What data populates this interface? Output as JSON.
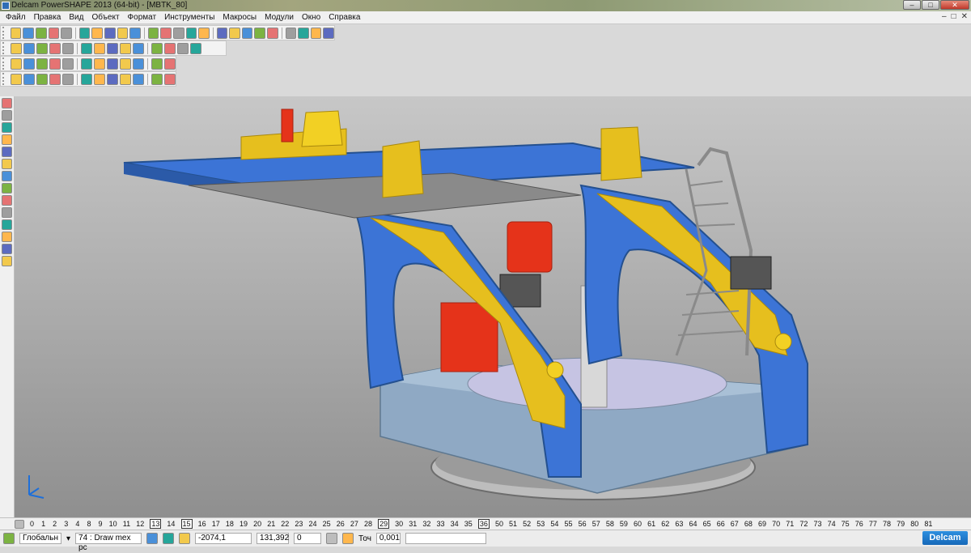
{
  "window": {
    "title": "Delcam PowerSHAPE 2013 (64-bit) - [MBTK_80]",
    "min": "–",
    "max": "□",
    "close": "✕"
  },
  "menu": [
    "Файл",
    "Правка",
    "Вид",
    "Объект",
    "Формат",
    "Инструменты",
    "Макросы",
    "Модули",
    "Окно",
    "Справка"
  ],
  "mdi_controls": [
    "–",
    "□",
    "✕"
  ],
  "toolbar_colors": [
    "#f2c94c",
    "#4a90d9",
    "#7cb342",
    "#e57373",
    "#9e9e9e",
    "#26a69a",
    "#ffb74d",
    "#5c6bc0"
  ],
  "levels": [
    "0",
    "1",
    "2",
    "3",
    "4",
    "8",
    "9",
    "10",
    "11",
    "12",
    "13",
    "14",
    "15",
    "16",
    "17",
    "18",
    "19",
    "20",
    "21",
    "22",
    "23",
    "24",
    "25",
    "26",
    "27",
    "28",
    "29",
    "30",
    "31",
    "32",
    "33",
    "34",
    "35",
    "36",
    "50",
    "51",
    "52",
    "53",
    "54",
    "55",
    "56",
    "57",
    "58",
    "59",
    "60",
    "61",
    "62",
    "63",
    "64",
    "65",
    "66",
    "67",
    "68",
    "69",
    "70",
    "71",
    "72",
    "73",
    "74",
    "75",
    "76",
    "77",
    "78",
    "79",
    "80",
    "81"
  ],
  "active_levels": [
    "13",
    "15",
    "29",
    "36"
  ],
  "status": {
    "workplane": "Глобальн",
    "level_value": "74 : Draw mex pc",
    "x_coord": "-2074,1",
    "y_coord": "131,392",
    "z_coord": "0",
    "tolerance_label": "Точ",
    "tolerance": "0,001"
  },
  "brand": "Delcam",
  "colors": {
    "blue": "#3c74d6",
    "yellow": "#e6bf1e",
    "red": "#e5331a",
    "grey_base": "#7f9fb8"
  }
}
